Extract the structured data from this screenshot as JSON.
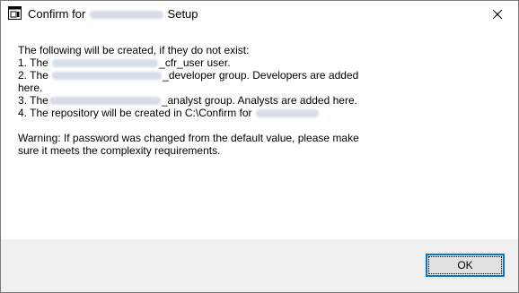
{
  "window": {
    "title_prefix": "Confirm for",
    "title_suffix": "Setup",
    "close_glyph": "✕",
    "icon": "application-window-icon"
  },
  "message": {
    "intro": "The following will be created, if they do not exist:",
    "item1_prefix": "1. The",
    "item1_suffix": "_cfr_user user.",
    "item2_prefix": "2. The",
    "item2_suffix": "_developer group. Developers are added",
    "item2_cont": "here.",
    "item3_prefix": "3. The",
    "item3_suffix": "_analyst group. Analysts are added here.",
    "item4_prefix": "4. The repository will be created in C:\\Confirm for",
    "warning_line1": "Warning: If password was changed from the default value, please make",
    "warning_line2": "sure it meets the complexity requirements."
  },
  "buttons": {
    "ok_label": "OK"
  },
  "colors": {
    "focus_border": "#0078d7",
    "footer_bg": "#f0f0f0",
    "button_bg": "#e1e1e1",
    "redaction": "#d6dce8"
  }
}
